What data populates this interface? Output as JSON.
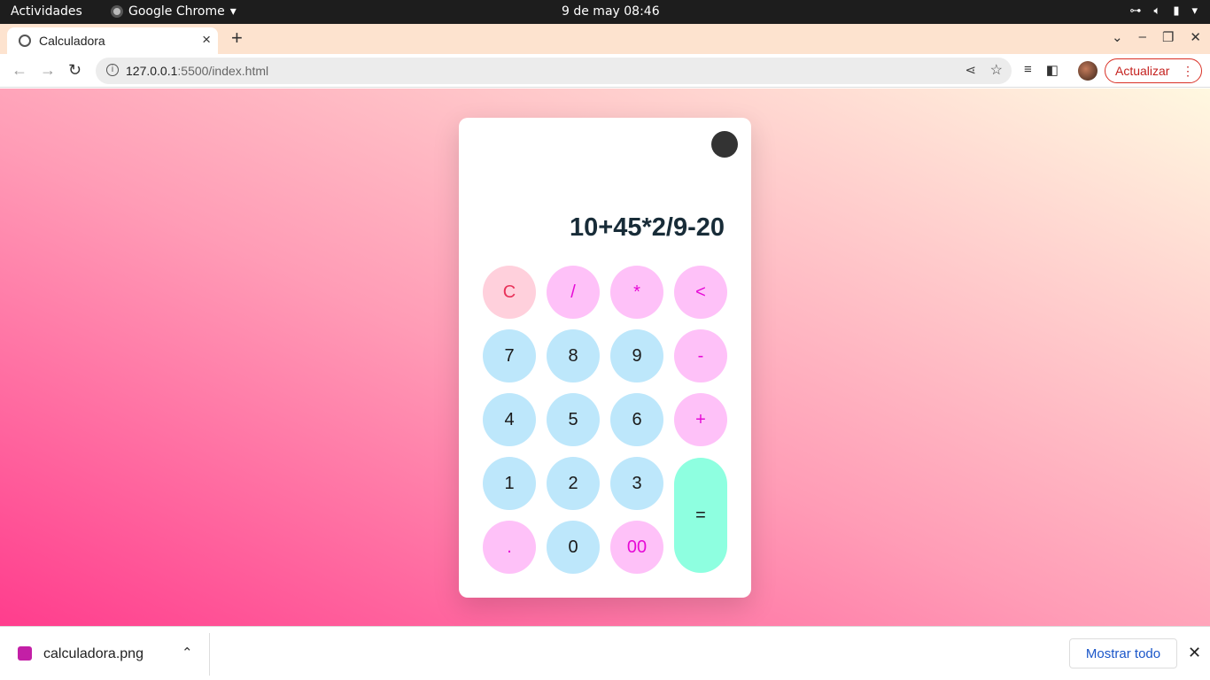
{
  "system_bar": {
    "activities": "Actividades",
    "app_name": "Google Chrome",
    "clock": "9 de may  08:46"
  },
  "browser": {
    "tab_title": "Calculadora",
    "url_host": "127.0.0.1",
    "url_rest": ":5500/index.html",
    "update_label": "Actualizar"
  },
  "calculator": {
    "display": "10+45*2/9-20",
    "buttons": {
      "clear": "C",
      "divide": "/",
      "multiply": "*",
      "backspace": "<",
      "seven": "7",
      "eight": "8",
      "nine": "9",
      "minus": "-",
      "four": "4",
      "five": "5",
      "six": "6",
      "plus": "+",
      "one": "1",
      "two": "2",
      "three": "3",
      "equals": "=",
      "dot": ".",
      "zero": "0",
      "double_zero": "00"
    },
    "colors": {
      "clear_bg": "#ffd0dc",
      "operator_bg": "#fec1f8",
      "number_bg": "#bde7fb",
      "equals_bg": "#8effe0"
    }
  },
  "downloads": {
    "file_name": "calculadora.png",
    "show_all": "Mostrar todo"
  }
}
